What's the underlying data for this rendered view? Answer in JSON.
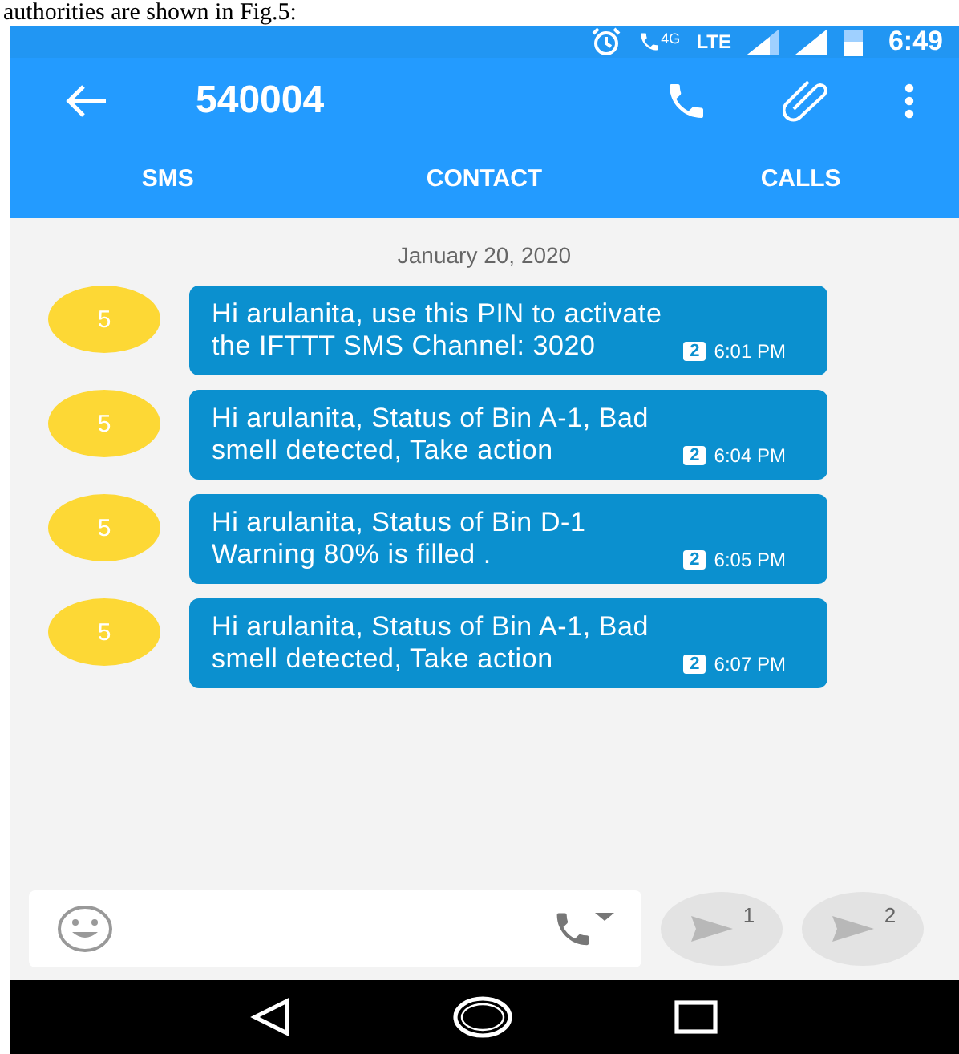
{
  "document_text": "authorities are shown in Fig.5:",
  "status_bar": {
    "network": "4G",
    "radio": "LTE",
    "time": "6:49"
  },
  "app_bar": {
    "title": "540004"
  },
  "tabs": [
    {
      "label": "SMS",
      "selected": false
    },
    {
      "label": "CONTACT",
      "selected": false
    },
    {
      "label": "CALLS",
      "selected": false
    }
  ],
  "date_header": "January 20, 2020",
  "messages": [
    {
      "avatar": "5",
      "text": "Hi arulanita, use this PIN to activate the IFTTT SMS Channel: 3020",
      "sim": "2",
      "time": "6:01 PM"
    },
    {
      "avatar": "5",
      "text": "Hi arulanita,  Status of Bin A-1, Bad smell  detected, Take action",
      "sim": "2",
      "time": "6:04 PM"
    },
    {
      "avatar": "5",
      "text": "Hi arulanita,  Status of Bin D-1 Warning 80% is filled .",
      "sim": "2",
      "time": "6:05 PM"
    },
    {
      "avatar": "5",
      "text": "Hi arulanita,  Status of Bin A-1, Bad smell  detected, Take action",
      "sim": "2",
      "time": "6:07 PM"
    }
  ],
  "send_buttons": [
    {
      "sim": "1",
      "disabled": true
    },
    {
      "sim": "2",
      "disabled": true
    }
  ]
}
